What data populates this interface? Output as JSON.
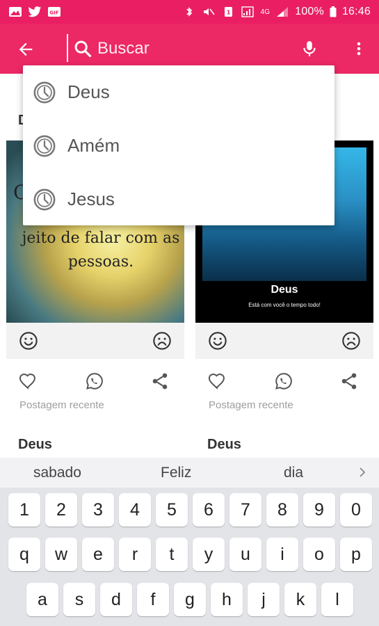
{
  "status_bar": {
    "left_icons": [
      "image-icon",
      "twitter-icon",
      "gif-icon"
    ],
    "right_icons": [
      "bluetooth-icon",
      "mute-icon",
      "sim-icon",
      "data-icon",
      "signal-icon"
    ],
    "network": "4G",
    "battery": "100%",
    "time": "16:46"
  },
  "app_bar": {
    "search_placeholder": "Buscar",
    "accent_color": "#e91e63"
  },
  "suggestions": [
    {
      "label": "Deus",
      "icon": "history-icon"
    },
    {
      "label": "Amém",
      "icon": "history-icon"
    },
    {
      "label": "Jesus",
      "icon": "history-icon"
    }
  ],
  "feed": {
    "section_title": "D",
    "cards": [
      {
        "image_text_partial": "jeito de falar com as pessoas.",
        "image_glyph": "C",
        "recent_label": "Postagem recente",
        "title": "Deus"
      },
      {
        "image_caption": "Deus",
        "image_subcaption": "Está com você o tempo todo!",
        "recent_label": "Postagem recente",
        "title": "Deus"
      }
    ]
  },
  "keyboard": {
    "predictions": [
      "sabado",
      "Feliz",
      "dia"
    ],
    "rows": [
      [
        "1",
        "2",
        "3",
        "4",
        "5",
        "6",
        "7",
        "8",
        "9",
        "0"
      ],
      [
        "q",
        "w",
        "e",
        "r",
        "t",
        "y",
        "u",
        "i",
        "o",
        "p"
      ],
      [
        "a",
        "s",
        "d",
        "f",
        "g",
        "h",
        "j",
        "k",
        "l"
      ]
    ]
  }
}
